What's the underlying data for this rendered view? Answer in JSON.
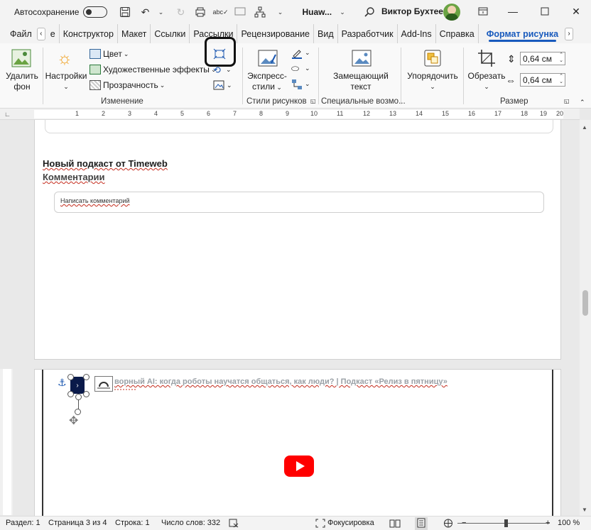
{
  "titlebar": {
    "autosave_label": "Автосохранение",
    "doc_name": "Huaw...",
    "user_name": "Виктор Бухтеев"
  },
  "tabs": [
    "Файл",
    "е",
    "Конструктор",
    "Макет",
    "Ссылки",
    "Рассылки",
    "Рецензирование",
    "Вид",
    "Разработчик",
    "Add-Ins",
    "Справка",
    "Формат рисунка"
  ],
  "ribbon": {
    "remove_bg": [
      "Удалить",
      "фон"
    ],
    "settings": "Настройки",
    "color": "Цвет",
    "art_effects": "Художественные эффекты",
    "transparency": "Прозрачность",
    "group_change": "Изменение",
    "express_styles": [
      "Экспресс-",
      "стили"
    ],
    "group_styles": "Стили рисунков",
    "alt_text": [
      "Замещающий",
      "текст"
    ],
    "group_accessibility": "Специальные возмо...",
    "arrange": "Упорядочить",
    "crop": "Обрезать",
    "height": "0,64 см",
    "width": "0,64 см",
    "group_size": "Размер"
  },
  "ruler": {
    "labels": [
      "1",
      "2",
      "3",
      "4",
      "5",
      "6",
      "7",
      "8",
      "9",
      "10",
      "11",
      "12",
      "13",
      "14",
      "15",
      "16",
      "17",
      "18",
      "19",
      "20"
    ]
  },
  "document": {
    "podcast_heading": "Новый подкаст от Timeweb",
    "comments_heading": "Комментарии",
    "comment_placeholder": "Написать   комментарий",
    "embed_title": "ворный AI: когда роботы научатся общаться, как люди? | Подкаст «Релиз в пятницу»"
  },
  "statusbar": {
    "section": "Раздел: 1",
    "page": "Страница 3 из 4",
    "line": "Строка: 1",
    "words": "Число слов: 332",
    "focus": "Фокусировка",
    "zoom": "100 %"
  }
}
